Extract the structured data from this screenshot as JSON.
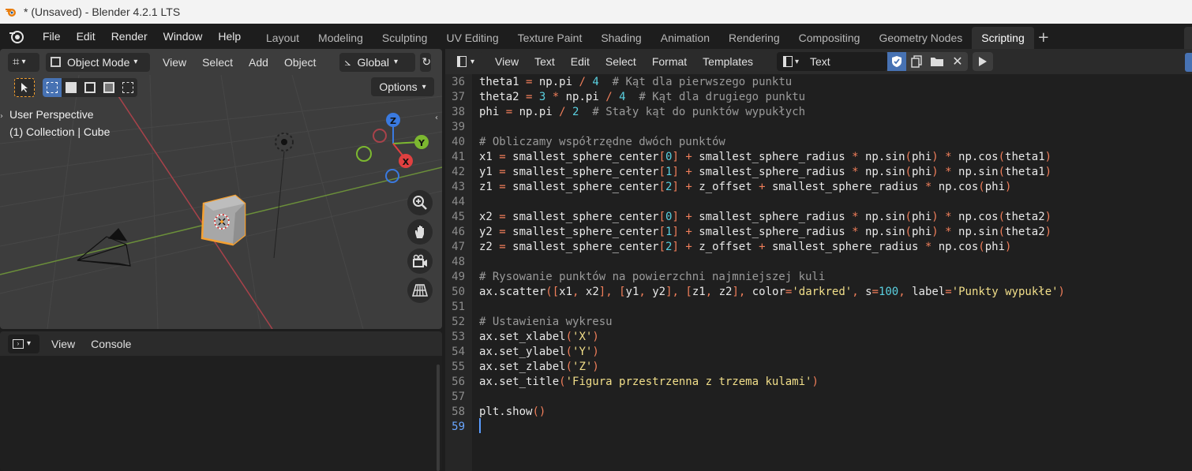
{
  "window": {
    "title": "* (Unsaved) - Blender 4.2.1 LTS"
  },
  "menu": [
    "File",
    "Edit",
    "Render",
    "Window",
    "Help"
  ],
  "workspace_tabs": [
    "Layout",
    "Modeling",
    "Sculpting",
    "UV Editing",
    "Texture Paint",
    "Shading",
    "Animation",
    "Rendering",
    "Compositing",
    "Geometry Nodes",
    "Scripting"
  ],
  "active_tab": "Scripting",
  "viewport": {
    "mode": "Object Mode",
    "menus": [
      "View",
      "Select",
      "Add",
      "Object"
    ],
    "transform": "Global",
    "options": "Options",
    "perspective": "User Perspective",
    "collection": "(1) Collection | Cube",
    "axes": {
      "x": "X",
      "y": "Y",
      "z": "Z"
    }
  },
  "console": {
    "menus": [
      "View",
      "Console"
    ]
  },
  "text_editor": {
    "menus": [
      "View",
      "Text",
      "Edit",
      "Select",
      "Format",
      "Templates"
    ],
    "datablock": "Text",
    "current_line": 59,
    "lines": [
      {
        "n": "36",
        "t": "theta1 = np.pi / 4  # Kąt dla pierwszego punktu"
      },
      {
        "n": "37",
        "t": "theta2 = 3 * np.pi / 4  # Kąt dla drugiego punktu"
      },
      {
        "n": "38",
        "t": "phi = np.pi / 2  # Stały kąt do punktów wypukłych"
      },
      {
        "n": "39",
        "t": ""
      },
      {
        "n": "40",
        "t": "# Obliczamy współrzędne dwóch punktów"
      },
      {
        "n": "41",
        "t": "x1 = smallest_sphere_center[0] + smallest_sphere_radius * np.sin(phi) * np.cos(theta1)"
      },
      {
        "n": "42",
        "t": "y1 = smallest_sphere_center[1] + smallest_sphere_radius * np.sin(phi) * np.sin(theta1)"
      },
      {
        "n": "43",
        "t": "z1 = smallest_sphere_center[2] + z_offset + smallest_sphere_radius * np.cos(phi)"
      },
      {
        "n": "44",
        "t": ""
      },
      {
        "n": "45",
        "t": "x2 = smallest_sphere_center[0] + smallest_sphere_radius * np.sin(phi) * np.cos(theta2)"
      },
      {
        "n": "46",
        "t": "y2 = smallest_sphere_center[1] + smallest_sphere_radius * np.sin(phi) * np.sin(theta2)"
      },
      {
        "n": "47",
        "t": "z2 = smallest_sphere_center[2] + z_offset + smallest_sphere_radius * np.cos(phi)"
      },
      {
        "n": "48",
        "t": ""
      },
      {
        "n": "49",
        "t": "# Rysowanie punktów na powierzchni najmniejszej kuli"
      },
      {
        "n": "50",
        "t": "ax.scatter([x1, x2], [y1, y2], [z1, z2], color='darkred', s=100, label='Punkty wypukłe')"
      },
      {
        "n": "51",
        "t": ""
      },
      {
        "n": "52",
        "t": "# Ustawienia wykresu"
      },
      {
        "n": "53",
        "t": "ax.set_xlabel('X')"
      },
      {
        "n": "54",
        "t": "ax.set_ylabel('Y')"
      },
      {
        "n": "55",
        "t": "ax.set_zlabel('Z')"
      },
      {
        "n": "56",
        "t": "ax.set_title('Figura przestrzenna z trzema kulami')"
      },
      {
        "n": "57",
        "t": ""
      },
      {
        "n": "58",
        "t": "plt.show()"
      },
      {
        "n": "59",
        "t": ""
      }
    ]
  },
  "colors": {
    "accent": "#4772b3",
    "selected_orange": "#f5a030",
    "x_axis": "#e04040",
    "y_axis": "#7cb830",
    "z_axis": "#3a7ae0"
  }
}
